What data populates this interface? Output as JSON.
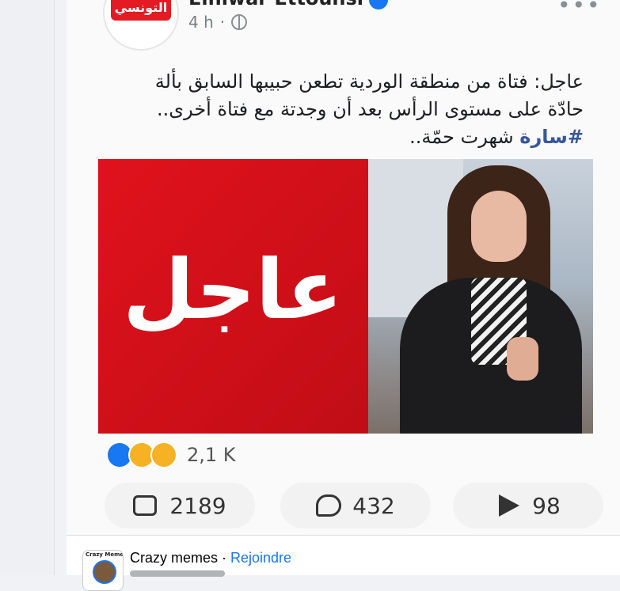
{
  "post": {
    "page_name": "Elhiwar Ettounsi",
    "avatar_logo_text": "التونسي",
    "time": "4 h",
    "separator": "·",
    "more": "•••",
    "text_line1": "عاجل: فتاة من منطقة الوردية تطعن حبيبها السابق بألة",
    "text_line2": "حادّة على مستوى الرأس بعد أن وجدتة مع فتاة أخرى..",
    "hashtag": "#سارة",
    "text_line3_rest": " شهرت حمّة..",
    "image_word": "عاجل",
    "reaction_count": "2,1 K",
    "like_count": "2189",
    "comment_count": "432",
    "share_count": "98"
  },
  "next_post": {
    "group_name": "Crazy memes",
    "separator": " · ",
    "join_label": "Rejoindre",
    "avatar_text": "Crazy Memes"
  },
  "colors": {
    "accent": "#1877f2",
    "breaking_red": "#e0121c",
    "hashtag": "#385898"
  }
}
